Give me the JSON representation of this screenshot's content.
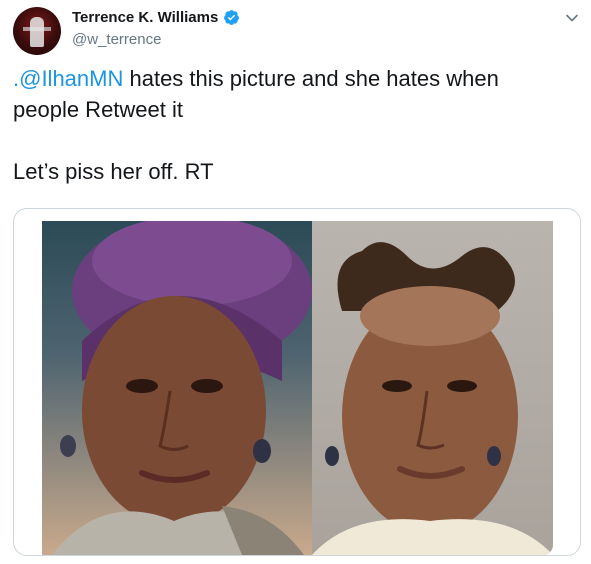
{
  "author": {
    "name": "Terrence K. Williams",
    "handle": "@w_terrence"
  },
  "tweet": {
    "mention": ".@IlhanMN",
    "text_after_mention": " hates this picture and she hates when\npeople Retweet it\n\nLet’s piss her off. RT"
  },
  "icons": {
    "verified": "verified-badge-icon",
    "menu": "chevron-down-icon"
  },
  "colors": {
    "link": "#1b95e0",
    "verified": "#1da1f2",
    "handle": "#657786"
  }
}
